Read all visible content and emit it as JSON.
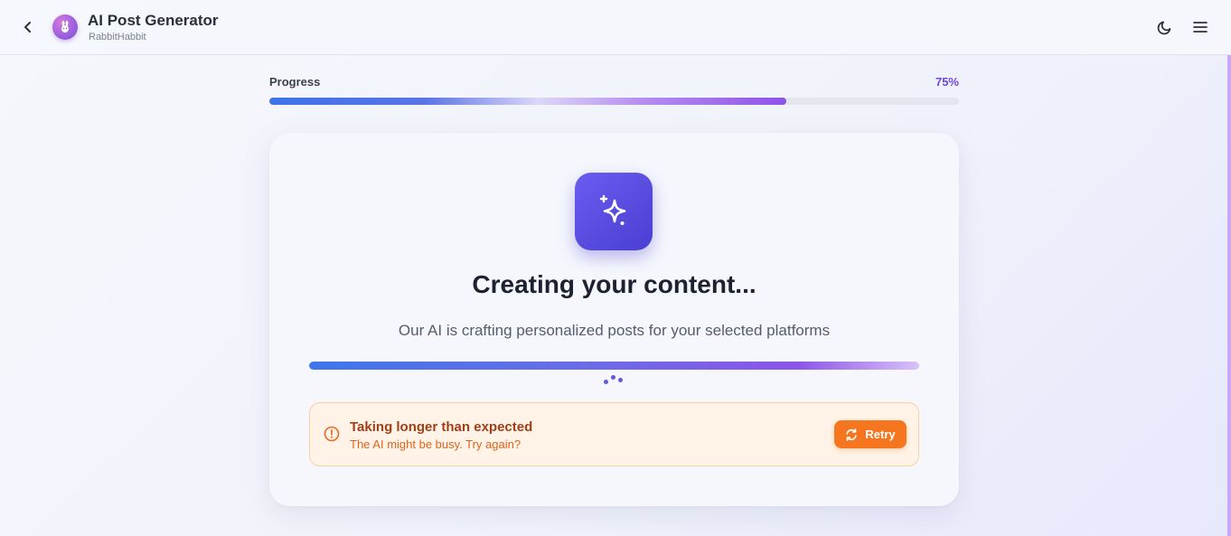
{
  "header": {
    "title": "AI Post Generator",
    "subtitle": "RabbitHabbit",
    "icons": [
      "back-arrow-icon",
      "rabbit-avatar",
      "moon-icon",
      "menu-icon"
    ]
  },
  "progress": {
    "label": "Progress",
    "percent_text": "75%",
    "value": 0.75
  },
  "card": {
    "icon": "sparkles-icon",
    "title": "Creating your content...",
    "description": "Our AI is crafting personalized posts for your selected platforms",
    "warning": {
      "icon": "alert-circle-icon",
      "title": "Taking longer than expected",
      "text": "The AI might be busy. Try again?",
      "retry_label": "Retry",
      "retry_icon": "refresh-icon"
    }
  },
  "colors": {
    "accent": "#6d45e0",
    "warning_bg": "#fff3e7",
    "warning_button": "#f5761f",
    "warning_title": "#a23f16",
    "warning_text": "#e0631d",
    "icon_tile": "#5a4be3"
  }
}
